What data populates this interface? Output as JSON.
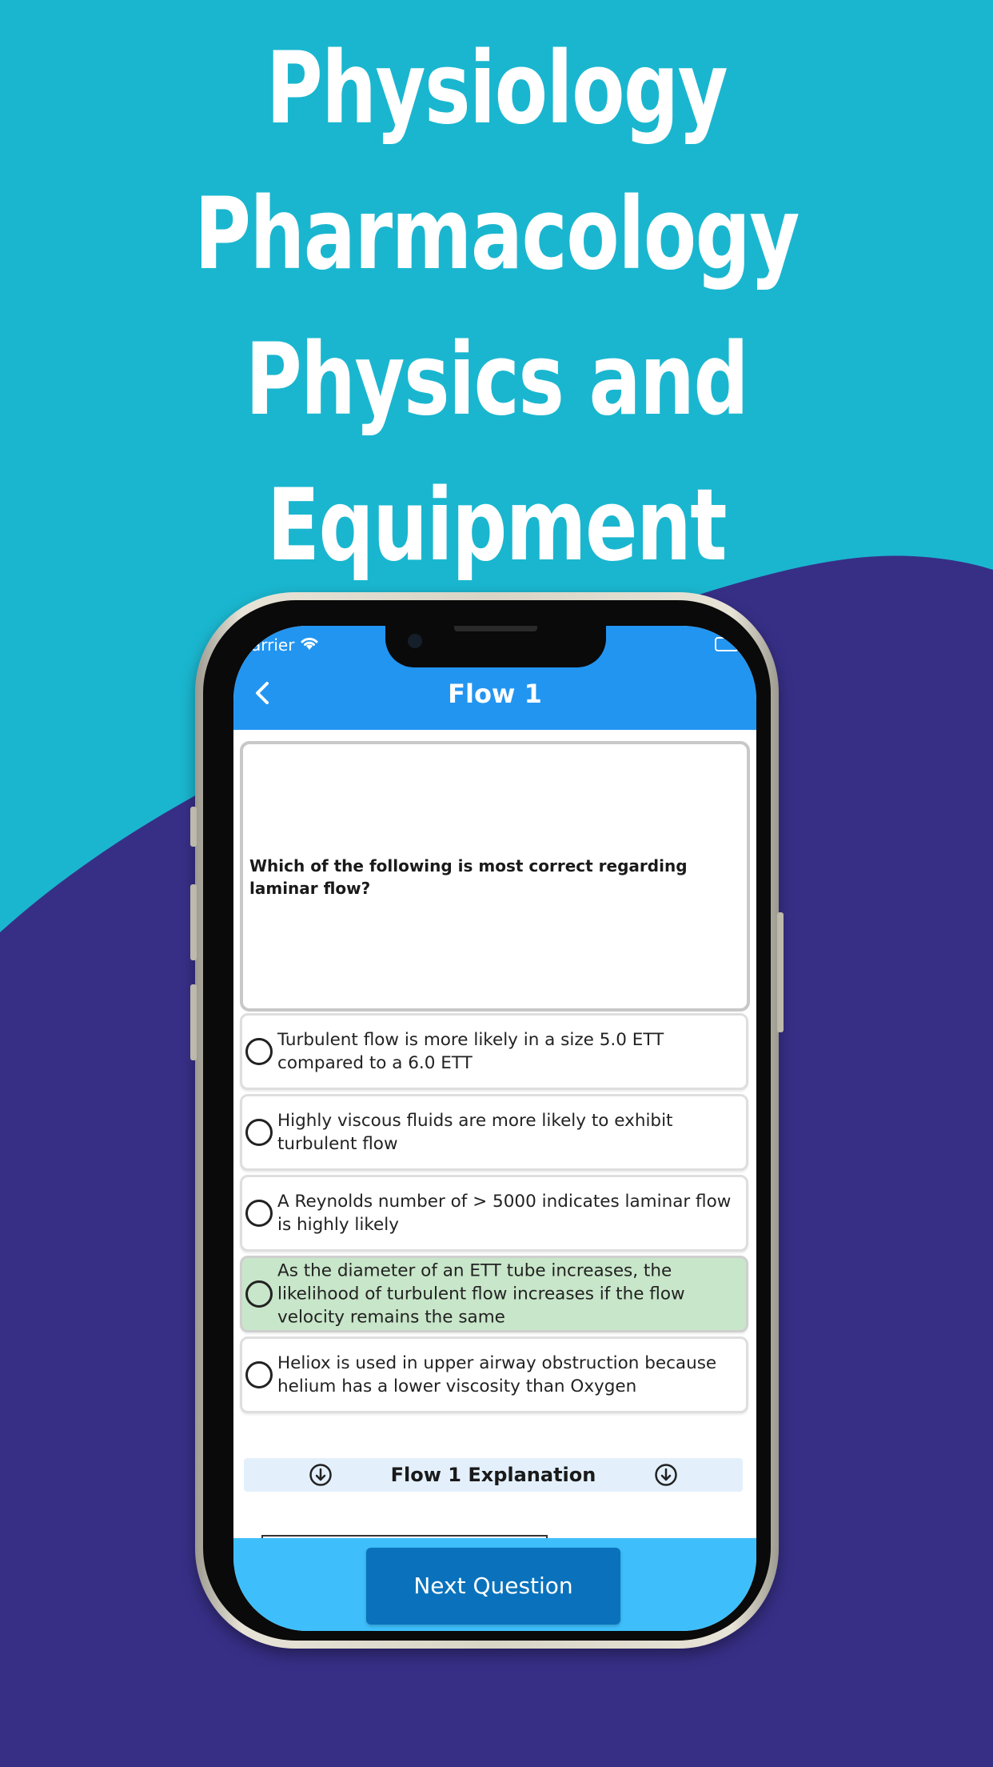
{
  "headline": {
    "lines": [
      "Physiology",
      "Pharmacology",
      "Physics and",
      "Equipment"
    ]
  },
  "colors": {
    "background_top": "#1ab6cf",
    "background_wave": "#372f86",
    "app_bar": "#2295f1",
    "bottom_bar": "#3ebffb",
    "next_button": "#0a72bc",
    "selected_option": "#c8e6c9",
    "explanation_bar": "#e3f0fc"
  },
  "status_bar": {
    "carrier": "arrier",
    "wifi_icon": "wifi-icon",
    "battery_icon": "battery-icon"
  },
  "app_bar": {
    "back_icon": "chevron-left-icon",
    "title": "Flow 1"
  },
  "question": {
    "text": "Which of the following is most correct regarding laminar flow?"
  },
  "options": [
    {
      "text": "Turbulent flow is more likely in a size 5.0 ETT compared to a 6.0 ETT",
      "selected": false
    },
    {
      "text": "Highly viscous fluids are more likely to exhibit turbulent flow",
      "selected": false
    },
    {
      "text": "A Reynolds number of > 5000 indicates laminar flow is highly likely",
      "selected": false
    },
    {
      "text": "As the diameter of an ETT tube increases, the likelihood of turbulent flow increases if the flow velocity remains the same",
      "selected": true
    },
    {
      "text": "Heliox is used in upper airway obstruction because helium has a lower viscosity than Oxygen",
      "selected": false
    }
  ],
  "explanation": {
    "title": "Flow 1 Explanation",
    "icon": "arrow-down-circle-icon"
  },
  "footer": {
    "next_button": "Next Question"
  }
}
